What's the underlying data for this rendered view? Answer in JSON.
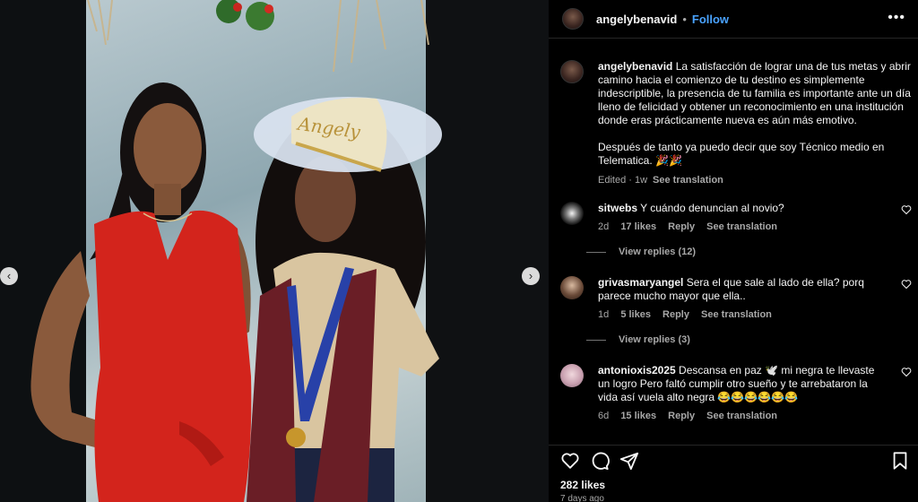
{
  "post": {
    "username": "angelybenavid",
    "follow_label": "Follow",
    "separator": "•",
    "more_label": "•••"
  },
  "photo": {
    "prev_label": "‹",
    "next_label": "›"
  },
  "caption": {
    "username": "angelybenavid",
    "text_p1": "La satisfacción de lograr una de tus metas y abrir camino hacia el comienzo de tu destino es simplemente indescriptible, la presencia de tu familia es importante ante un día lleno de felicidad y obtener un reconocimiento en una institución donde eras prácticamente nueva es aún más emotivo.",
    "text_p2": "Después de tanto ya puedo decir que soy Técnico medio en Telematica. 🎉🎉",
    "meta": "Edited · 1w",
    "see_translation": "See translation"
  },
  "comments": [
    {
      "username": "sitwebs",
      "text": "Y cuándo denuncian al novio?",
      "time": "2d",
      "likes": "17 likes",
      "reply": "Reply",
      "see_translation": "See translation",
      "view_replies": "View replies (12)"
    },
    {
      "username": "grivasmaryangel",
      "text": "Sera el que sale al lado de ella? porq parece mucho mayor que ella..",
      "time": "1d",
      "likes": "5 likes",
      "reply": "Reply",
      "see_translation": "See translation",
      "view_replies": "View replies (3)"
    },
    {
      "username": "antonioxis2025",
      "text": "Descansa en paz 🕊️ mi negra te llevaste un logro Pero faltó cumplir otro sueño y te arrebataron la vida así vuela alto negra 😂😂😂😂😂😂",
      "time": "6d",
      "likes": "15 likes",
      "reply": "Reply",
      "see_translation": "See translation"
    }
  ],
  "footer": {
    "likes": "282 likes",
    "date": "7 days ago"
  },
  "icons": {
    "like": "heart-icon",
    "comment": "comment-icon",
    "share": "share-icon",
    "save": "bookmark-icon"
  },
  "colors": {
    "link": "#4aa3ff",
    "panel_bg": "#000000",
    "muted": "#a8a8a8"
  }
}
